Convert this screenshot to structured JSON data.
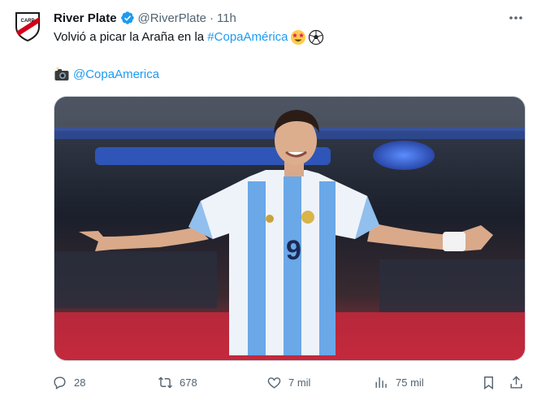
{
  "post": {
    "display_name": "River Plate",
    "handle": "@RiverPlate",
    "separator": "·",
    "time": "11h",
    "text_main": "Volvió a picar la Araña en la ",
    "hashtag": "#CopaAmérica",
    "credit_mention": "@CopaAmerica",
    "avatar_icon": "river-plate-crest-icon",
    "verified_icon": "verified-badge-icon",
    "emojis_line1": [
      "star-struck-emoji",
      "soccer-ball-emoji"
    ],
    "emoji_line2": "camera-flash-emoji",
    "image_icon": "football-player-celebration-photo"
  },
  "actions": {
    "replies": "28",
    "reposts": "678",
    "likes": "7 mil",
    "views": "75 mil"
  },
  "colors": {
    "text": "#0f1419",
    "secondary": "#536471",
    "link": "#1d9bf0",
    "verified": "#1d9bf0"
  }
}
